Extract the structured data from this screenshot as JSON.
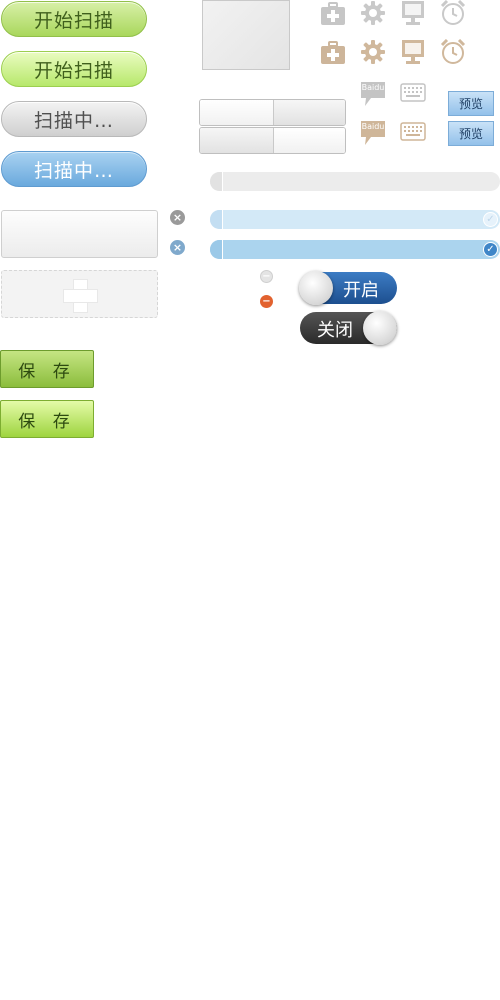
{
  "scan_buttons": {
    "start_label": "开始扫描",
    "start_hover_label": "开始扫描",
    "scanning_label": "扫描中…",
    "scanning_active_label": "扫描中…"
  },
  "save_buttons": {
    "save_label": "保 存",
    "save_hover_label": "保 存"
  },
  "preview_buttons": {
    "preview_label": "预览",
    "preview_label_2": "预览"
  },
  "baidu_icons": {
    "label": "Baidu"
  },
  "toggles": {
    "on_label": "开启",
    "off_label": "关闭"
  },
  "progress": {
    "empty_fraction": 0,
    "half_fraction": 1,
    "full_fraction": 1
  },
  "colors": {
    "green_button": "#a9d75c",
    "blue_button": "#6aa9dd",
    "toggle_on": "#2b63a6",
    "toggle_off": "#3a3a3a",
    "save_green": "#8bbd3c",
    "remove_red": "#e2622f",
    "bar_light_blue": "#d3e9f7",
    "bar_blue": "#abd4ee",
    "check_blue": "#3f86c8"
  }
}
